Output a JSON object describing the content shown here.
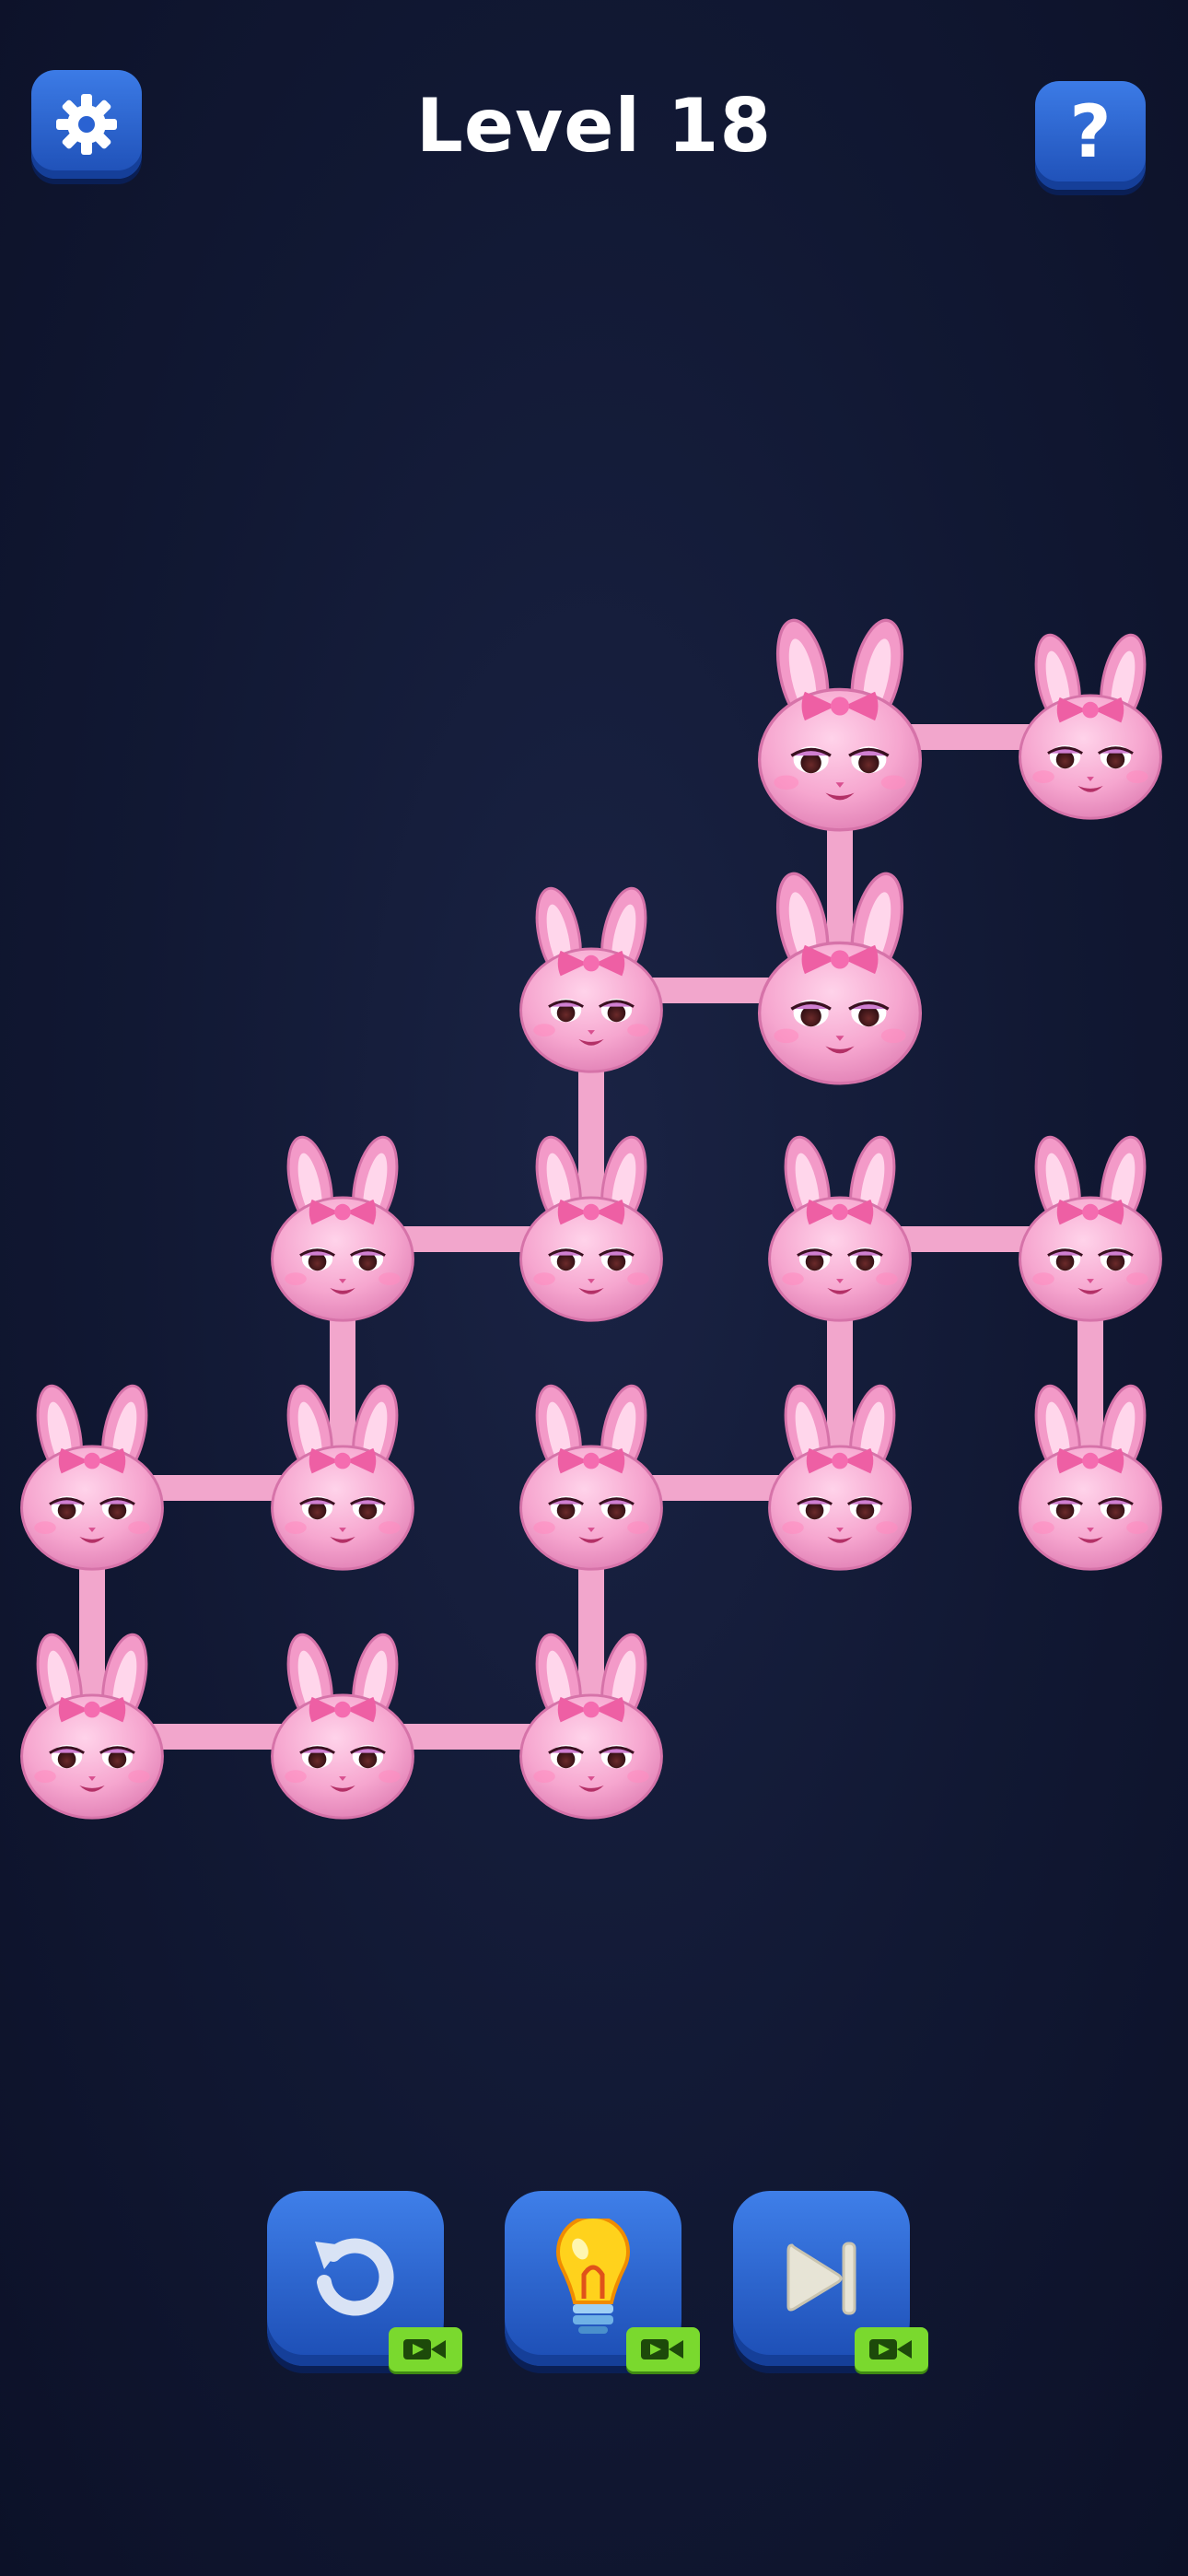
{
  "header": {
    "title": "Level 18"
  },
  "icons": {
    "settings": "gear-icon",
    "help": "question-mark-icon",
    "undo": "undo-arrow-icon",
    "hint": "lightbulb-icon",
    "skip": "skip-forward-icon",
    "video": "video-camera-icon"
  },
  "help_label": "?",
  "colors": {
    "background": "#111833",
    "button": "#2a62d2",
    "bunny": "#f4a3cd",
    "connector": "#f2a6cc",
    "badge": "#7ad92e"
  },
  "board": {
    "nodes": [
      {
        "id": "A",
        "col": 3,
        "row": 0,
        "big": true
      },
      {
        "id": "B",
        "col": 4,
        "row": 0,
        "big": false
      },
      {
        "id": "C",
        "col": 2,
        "row": 1,
        "big": false
      },
      {
        "id": "D",
        "col": 3,
        "row": 1,
        "big": true
      },
      {
        "id": "E",
        "col": 1,
        "row": 2,
        "big": false
      },
      {
        "id": "F",
        "col": 2,
        "row": 2,
        "big": false
      },
      {
        "id": "G",
        "col": 3,
        "row": 2,
        "big": false
      },
      {
        "id": "H",
        "col": 4,
        "row": 2,
        "big": false
      },
      {
        "id": "I",
        "col": 0,
        "row": 3,
        "big": false
      },
      {
        "id": "J",
        "col": 1,
        "row": 3,
        "big": false
      },
      {
        "id": "K",
        "col": 2,
        "row": 3,
        "big": false
      },
      {
        "id": "L",
        "col": 3,
        "row": 3,
        "big": false
      },
      {
        "id": "M",
        "col": 4,
        "row": 3,
        "big": false
      },
      {
        "id": "N",
        "col": 0,
        "row": 4,
        "big": false
      },
      {
        "id": "O",
        "col": 1,
        "row": 4,
        "big": false
      },
      {
        "id": "P",
        "col": 2,
        "row": 4,
        "big": false
      }
    ],
    "links": [
      [
        "A",
        "B"
      ],
      [
        "A",
        "D"
      ],
      [
        "C",
        "D"
      ],
      [
        "C",
        "F"
      ],
      [
        "E",
        "F"
      ],
      [
        "E",
        "J"
      ],
      [
        "I",
        "J"
      ],
      [
        "I",
        "N"
      ],
      [
        "N",
        "O"
      ],
      [
        "O",
        "P"
      ],
      [
        "P",
        "K"
      ],
      [
        "K",
        "L"
      ],
      [
        "G",
        "L"
      ],
      [
        "G",
        "H"
      ],
      [
        "H",
        "M"
      ]
    ]
  }
}
